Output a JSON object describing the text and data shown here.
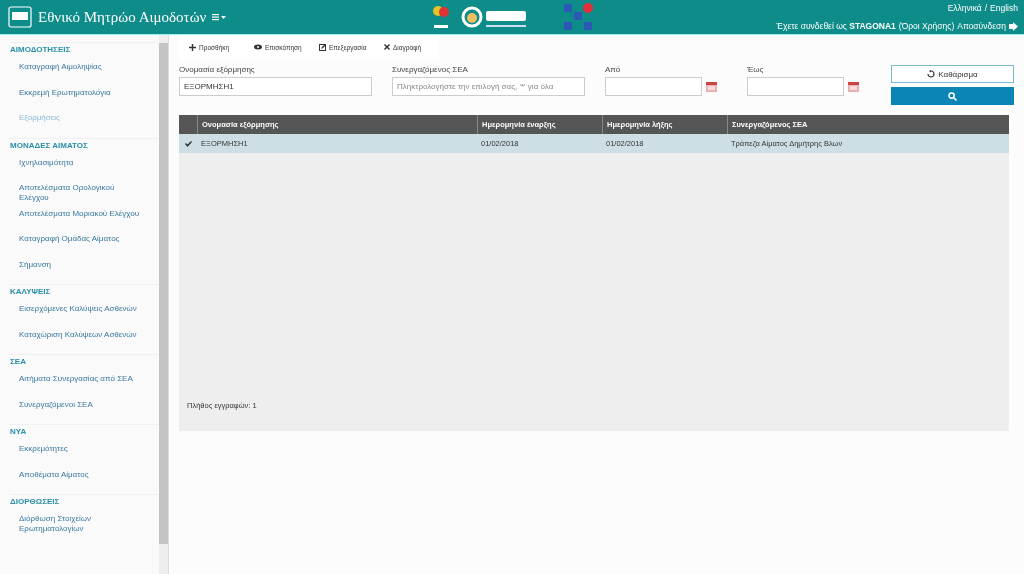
{
  "header": {
    "brand": "Εθνικό Μητρώο Αιμοδοτών",
    "languages": [
      {
        "label": "Ελληνικά"
      },
      {
        "label": "English"
      }
    ],
    "language_separator": "/",
    "session": {
      "prefix": "Έχετε συνδεθεί ως",
      "user": "STAGONA1",
      "terms": "(Όροι Χρήσης)",
      "logout": "Αποσύνδεση"
    }
  },
  "sidebar": {
    "sections": [
      {
        "title": "ΑΙΜΟΔΟΤΗΣΕΙΣ",
        "items": [
          {
            "label": "Καταγραφή Αιμοληψίας",
            "selected": false
          },
          {
            "label": "Εκκρεμή Ερωτηματολόγια",
            "selected": false
          },
          {
            "label": "Εξορμήσεις",
            "selected": true
          }
        ]
      },
      {
        "title": "ΜΟΝΑΔΕΣ ΑΙΜΑΤΟΣ",
        "items": [
          {
            "label": "Ιχνηλασιμότητα",
            "selected": false
          },
          {
            "label": "Αποτελέσματα Ορολογικού Ελέγχου",
            "selected": false
          },
          {
            "label": "Αποτελέσματα Μοριακού Ελέγχου",
            "selected": false
          },
          {
            "label": "Καταγραφή Ομάδας Αίματος",
            "selected": false
          },
          {
            "label": "Σήμανση",
            "selected": false
          }
        ]
      },
      {
        "title": "ΚΑΛΥΨΕΙΣ",
        "items": [
          {
            "label": "Εισερχόμενες Καλύψεις Ασθενών",
            "selected": false
          },
          {
            "label": "Καταχώριση Καλύψεων Ασθενών",
            "selected": false
          }
        ]
      },
      {
        "title": "ΣΕΑ",
        "items": [
          {
            "label": "Αιτήματα Συνεργασίας από ΣΕΑ",
            "selected": false
          },
          {
            "label": "Συνεργαζόμενοι ΣΕΑ",
            "selected": false
          }
        ]
      },
      {
        "title": "ΝΥΑ",
        "items": [
          {
            "label": "Εκκρεμότητες",
            "selected": false
          },
          {
            "label": "Αποθέματα Αίματος",
            "selected": false
          }
        ]
      },
      {
        "title": "ΔΙΟΡΘΩΣΕΙΣ",
        "items": [
          {
            "label": "Διόρθωση Στοιχείων Ερωτηματολογίων",
            "selected": false
          }
        ]
      }
    ]
  },
  "toolbar": [
    {
      "kind": "add",
      "label": "Προσθήκη"
    },
    {
      "kind": "view",
      "label": "Επισκόπηση"
    },
    {
      "kind": "edit",
      "label": "Επεξεργασία"
    },
    {
      "kind": "delete",
      "label": "Διαγραφή"
    }
  ],
  "filters": {
    "name": {
      "label": "Ονομασία εξόρμησης",
      "value": "ΕΞΟΡΜΗΣΗ1"
    },
    "partner": {
      "label": "Συνεργαζόμενος ΣΕΑ",
      "placeholder": "Πληκτρολογήστε την επιλογή σας, '*' για όλα"
    },
    "from": {
      "label": "Από"
    },
    "to": {
      "label": "Έως"
    },
    "clear": "Καθάρισμα"
  },
  "table": {
    "columns": [
      "Ονομασία εξόρμησης",
      "Ημερομηνία έναρξης",
      "Ημερομηνία λήξης",
      "Συνεργαζόμενος ΣΕΑ"
    ],
    "rows": [
      {
        "selected": true,
        "cells": [
          "ΕΞΟΡΜΗΣΗ1",
          "01/02/2018",
          "01/02/2018",
          "Τράπεζα Αίματος Δημήτρης Βλων"
        ]
      }
    ],
    "footer": "Πλήθος εγγραφών: 1"
  }
}
